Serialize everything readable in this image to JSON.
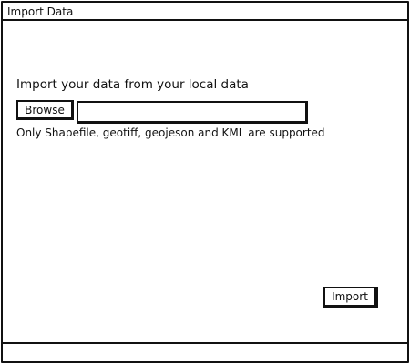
{
  "window": {
    "title": "Import Data"
  },
  "main": {
    "heading": "Import your data from your local data",
    "browse_label": "Browse",
    "file_path_value": "",
    "hint": "Only Shapefile, geotiff, geojeson and KML are supported",
    "import_label": "Import"
  },
  "statusbar": {
    "text": ""
  }
}
